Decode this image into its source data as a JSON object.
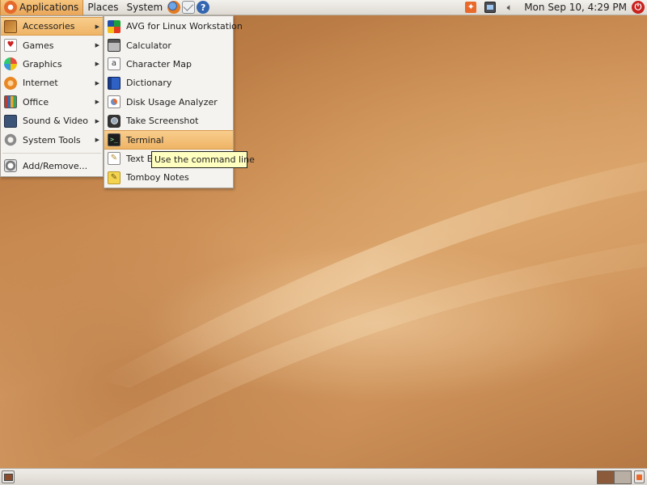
{
  "top_panel": {
    "menus": {
      "applications": "Applications",
      "places": "Places",
      "system": "System"
    },
    "launchers": {
      "firefox_icon": "firefox-icon",
      "mail_icon": "mail-icon",
      "help_glyph": "?"
    },
    "clock": "Mon Sep 10,  4:29 PM"
  },
  "applications_menu": {
    "items": [
      {
        "label": "Accessories",
        "icon": "accessories-icon",
        "submenu": true,
        "highlighted": true
      },
      {
        "label": "Games",
        "icon": "games-icon",
        "submenu": true
      },
      {
        "label": "Graphics",
        "icon": "graphics-icon",
        "submenu": true
      },
      {
        "label": "Internet",
        "icon": "internet-icon",
        "submenu": true
      },
      {
        "label": "Office",
        "icon": "office-icon",
        "submenu": true
      },
      {
        "label": "Sound & Video",
        "icon": "sound-video-icon",
        "submenu": true
      },
      {
        "label": "System Tools",
        "icon": "system-tools-icon",
        "submenu": true
      }
    ],
    "footer_item": {
      "label": "Add/Remove...",
      "icon": "add-remove-icon"
    }
  },
  "accessories_submenu": {
    "items": [
      {
        "label": "AVG for Linux Workstation",
        "icon": "avg-icon"
      },
      {
        "label": "Calculator",
        "icon": "calculator-icon"
      },
      {
        "label": "Character Map",
        "icon": "charmap-icon",
        "glyph": "a"
      },
      {
        "label": "Dictionary",
        "icon": "dictionary-icon"
      },
      {
        "label": "Disk Usage Analyzer",
        "icon": "disk-usage-icon"
      },
      {
        "label": "Take Screenshot",
        "icon": "screenshot-icon"
      },
      {
        "label": "Terminal",
        "icon": "terminal-icon",
        "highlighted": true,
        "glyph": ">_"
      },
      {
        "label": "Text Editor",
        "icon": "text-editor-icon",
        "glyph": "✎"
      },
      {
        "label": "Tomboy Notes",
        "icon": "tomboy-icon",
        "glyph": "✎"
      }
    ]
  },
  "tooltip": "Use the command line",
  "colors": {
    "highlight": "#efb466",
    "panel": "#e6e3de",
    "tooltip_bg": "#ffffbf",
    "wallpaper": "#c88a50"
  }
}
